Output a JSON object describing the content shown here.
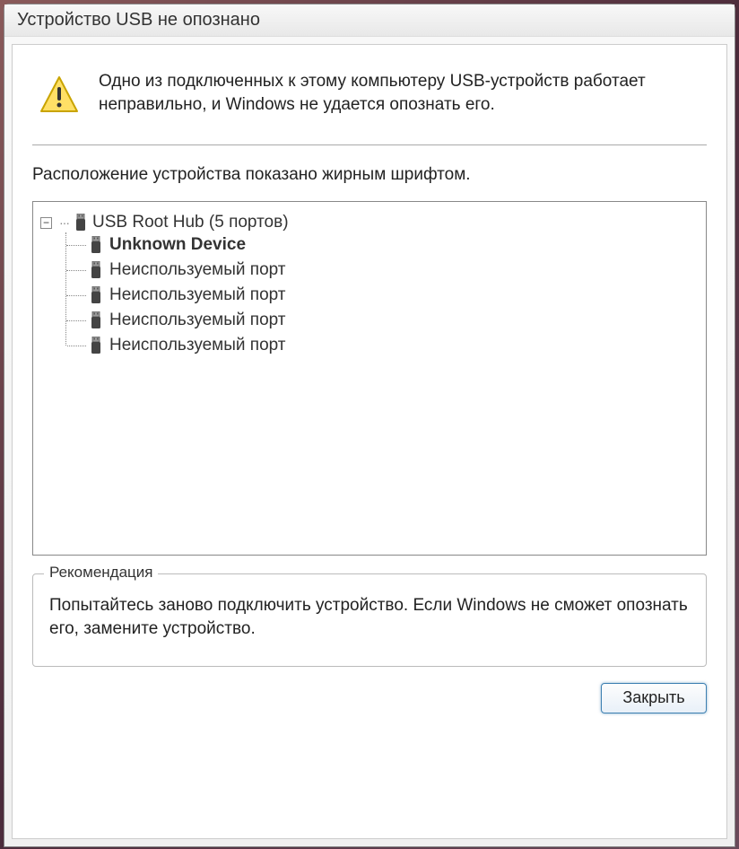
{
  "window": {
    "title": "Устройство USB не опознано"
  },
  "alert": {
    "message": "Одно из подключенных к этому компьютеру USB-устройств работает неправильно, и Windows не удается опознать его."
  },
  "location": {
    "text": "Расположение устройства показано жирным шрифтом."
  },
  "tree": {
    "root": {
      "label": "USB Root Hub (5 портов)",
      "icon": "usb-icon"
    },
    "children": [
      {
        "label": "Unknown Device",
        "bold": true,
        "icon": "usb-icon"
      },
      {
        "label": "Неиспользуемый порт",
        "bold": false,
        "icon": "usb-icon"
      },
      {
        "label": "Неиспользуемый порт",
        "bold": false,
        "icon": "usb-icon"
      },
      {
        "label": "Неиспользуемый порт",
        "bold": false,
        "icon": "usb-icon"
      },
      {
        "label": "Неиспользуемый порт",
        "bold": false,
        "icon": "usb-icon"
      }
    ]
  },
  "recommendation": {
    "legend": "Рекомендация",
    "text": "Попытайтесь заново подключить устройство. Если Windows не сможет опознать его, замените устройство."
  },
  "buttons": {
    "close": "Закрыть"
  }
}
